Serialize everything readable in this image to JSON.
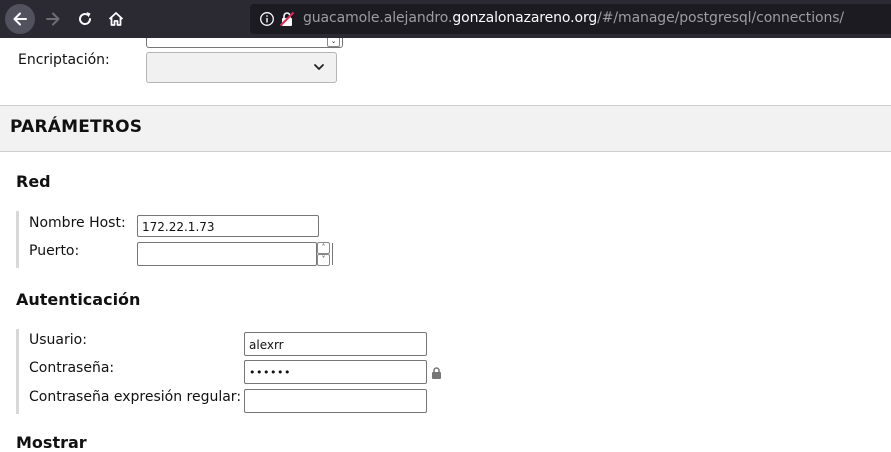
{
  "browser": {
    "url_prefix": "guacamole.alejandro.",
    "url_domain": "gonzalonazareno.org",
    "url_path": "/#/manage/postgresql/connections/"
  },
  "encryption": {
    "label": "Encriptación:",
    "selected_value": ""
  },
  "parameters": {
    "title": "PARÁMETROS",
    "network": {
      "title": "Red",
      "hostname_label": "Nombre Host:",
      "hostname_value": "172.22.1.73",
      "port_label": "Puerto:",
      "port_value": ""
    },
    "authentication": {
      "title": "Autenticación",
      "username_label": "Usuario:",
      "username_value": "alexrr",
      "password_label": "Contraseña:",
      "password_value": "••••••",
      "password_regex_label": "Contraseña expresión regular:",
      "password_regex_value": ""
    },
    "next_section_title": "Mostrar"
  },
  "icons": {
    "back": "arrow-left-icon",
    "forward": "arrow-right-icon",
    "reload": "reload-icon",
    "home": "home-icon",
    "info": "info-icon",
    "insecure": "insecure-lock-icon",
    "password_lock": "lock-icon"
  }
}
